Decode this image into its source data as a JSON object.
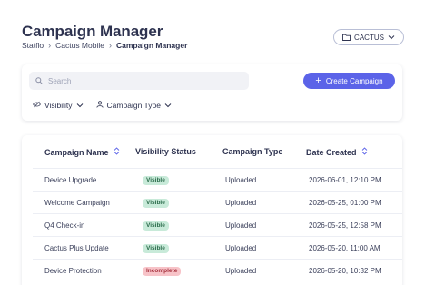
{
  "header": {
    "title": "Campaign Manager",
    "breadcrumb": [
      "Statflo",
      "Cactus Mobile",
      "Campaign Manager"
    ],
    "org_button_label": "CACTUS"
  },
  "toolbar": {
    "search_placeholder": "Search",
    "create_button_label": "Create Campaign",
    "filters": [
      "Visibility",
      "Campaign Type"
    ]
  },
  "table": {
    "columns": [
      "Campaign Name",
      "Visibility Status",
      "Campaign Type",
      "Date Created"
    ],
    "rows": [
      {
        "name": "Device Upgrade",
        "status": "Visible",
        "type": "Uploaded",
        "date": "2026-06-01, 12:10 PM"
      },
      {
        "name": "Welcome Campaign",
        "status": "Visible",
        "type": "Uploaded",
        "date": "2026-05-25, 01:00 PM"
      },
      {
        "name": "Q4 Check-in",
        "status": "Visible",
        "type": "Uploaded",
        "date": "2026-05-25, 12:58 PM"
      },
      {
        "name": "Cactus Plus Update",
        "status": "Visible",
        "type": "Uploaded",
        "date": "2026-05-20, 11:00 AM"
      },
      {
        "name": "Device Protection",
        "status": "Incomplete",
        "type": "Uploaded",
        "date": "2026-05-20, 10:32 PM"
      }
    ]
  },
  "colors": {
    "accent": "#5b63e8",
    "visible_badge": "#c8ead9",
    "incomplete_badge": "#f7c3c8",
    "text": "#2e3350"
  },
  "icons": [
    "folder-icon",
    "chevron-down-icon",
    "search-icon",
    "plus-icon",
    "eye-icon",
    "user-icon",
    "sort-icon",
    "chevron-right-icon"
  ]
}
